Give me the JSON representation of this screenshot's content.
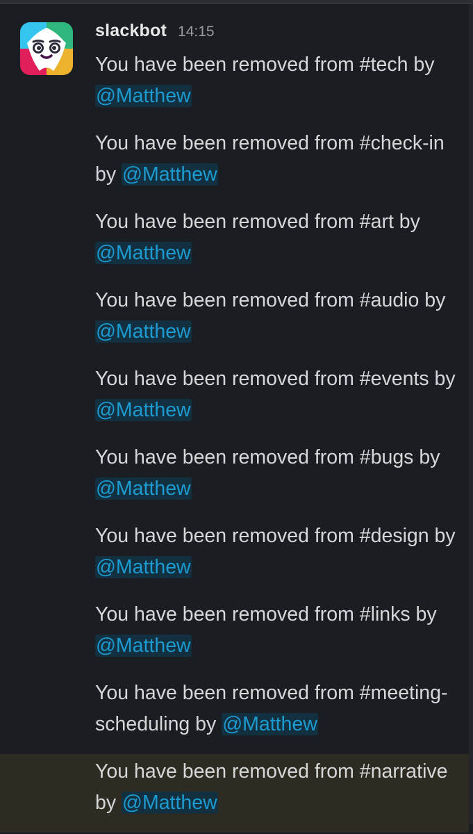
{
  "sender": {
    "name": "slackbot",
    "time": "14:15"
  },
  "messages": [
    {
      "text": "You have been removed from #tech by ",
      "mention": "@Matthew",
      "highlighted": false
    },
    {
      "text": "You have been removed from #check-in by ",
      "mention": "@Matthew",
      "highlighted": false
    },
    {
      "text": "You have been removed from #art by ",
      "mention": "@Matthew",
      "highlighted": false
    },
    {
      "text": "You have been removed from #audio by ",
      "mention": "@Matthew",
      "highlighted": false
    },
    {
      "text": "You have been removed from #events by ",
      "mention": "@Matthew",
      "highlighted": false
    },
    {
      "text": "You have been removed from #bugs by ",
      "mention": "@Matthew",
      "highlighted": false
    },
    {
      "text": "You have been removed from #design by ",
      "mention": "@Matthew",
      "highlighted": false
    },
    {
      "text": "You have been removed from #links by ",
      "mention": "@Matthew",
      "highlighted": false
    },
    {
      "text": "You have been removed from #meeting-scheduling by ",
      "mention": "@Matthew",
      "highlighted": false
    },
    {
      "text": "You have been removed from #narrative by ",
      "mention": "@Matthew",
      "highlighted": true
    }
  ],
  "colors": {
    "background": "#1a1d21",
    "text": "#d6d7d8",
    "mention_text": "#1d9bd1",
    "mention_background": "#12303f",
    "highlight_background": "#2d2b22"
  },
  "icons": {
    "avatar": "slackbot-avatar-icon"
  }
}
